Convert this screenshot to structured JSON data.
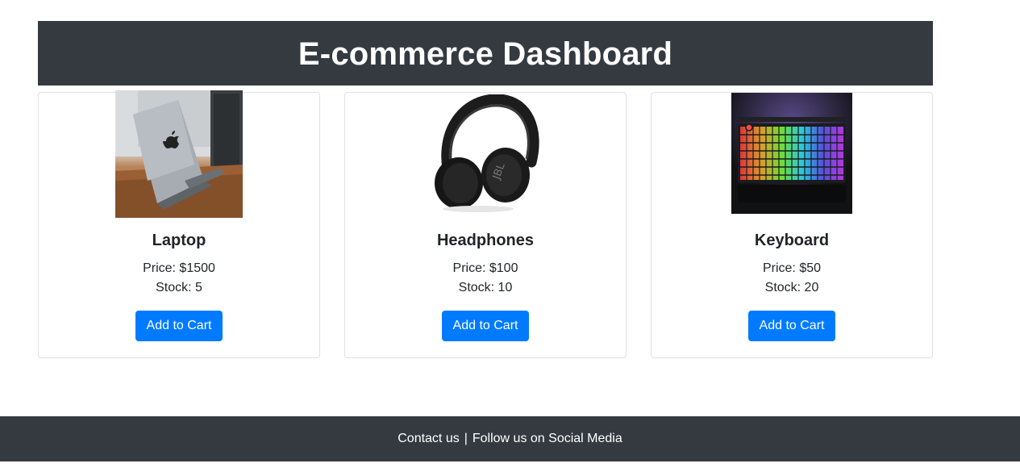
{
  "header": {
    "title": "E-commerce Dashboard"
  },
  "products": [
    {
      "name": "Laptop",
      "price": "Price: $1500",
      "stock": "Stock: 5",
      "button_label": "Add to Cart",
      "image_icon": "laptop-image"
    },
    {
      "name": "Headphones",
      "price": "Price: $100",
      "stock": "Stock: 10",
      "button_label": "Add to Cart",
      "image_icon": "headphones-image"
    },
    {
      "name": "Keyboard",
      "price": "Price: $50",
      "stock": "Stock: 20",
      "button_label": "Add to Cart",
      "image_icon": "keyboard-image"
    }
  ],
  "footer": {
    "contact": "Contact us",
    "separator": "|",
    "social": "Follow us on Social Media"
  },
  "colors": {
    "header_bg": "#343a40",
    "footer_bg": "#343a40",
    "button_bg": "#007bff",
    "card_border": "#dee2e6"
  }
}
